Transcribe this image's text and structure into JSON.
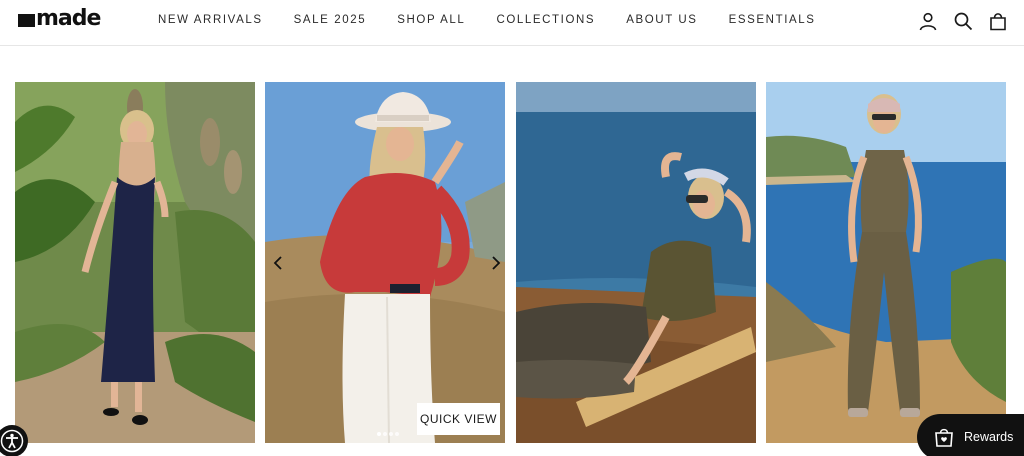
{
  "brand": {
    "name": "made"
  },
  "nav": {
    "items": [
      "NEW ARRIVALS",
      "SALE 2025",
      "SHOP ALL",
      "COLLECTIONS",
      "ABOUT US",
      "ESSENTIALS"
    ]
  },
  "header_icons": [
    "account-icon",
    "search-icon",
    "cart-bag-icon"
  ],
  "products": [
    {
      "photo": "model-navy-slip-dress-garden"
    },
    {
      "photo": "model-red-sweater-white-pants-hat",
      "quick_view_label": "QUICK VIEW",
      "image_dots": 4,
      "active_dot": 0
    },
    {
      "photo": "model-olive-tank-reclining-ocean"
    },
    {
      "photo": "model-olive-jumpsuit-cliff-ocean"
    }
  ],
  "widgets": {
    "accessibility_icon": "accessibility-icon",
    "rewards_label": "Rewards",
    "rewards_icon": "gift-bag-icon"
  },
  "colors": {
    "text": "#1a1a1a",
    "widget_bg": "#111111",
    "border": "#e6e6e6"
  }
}
